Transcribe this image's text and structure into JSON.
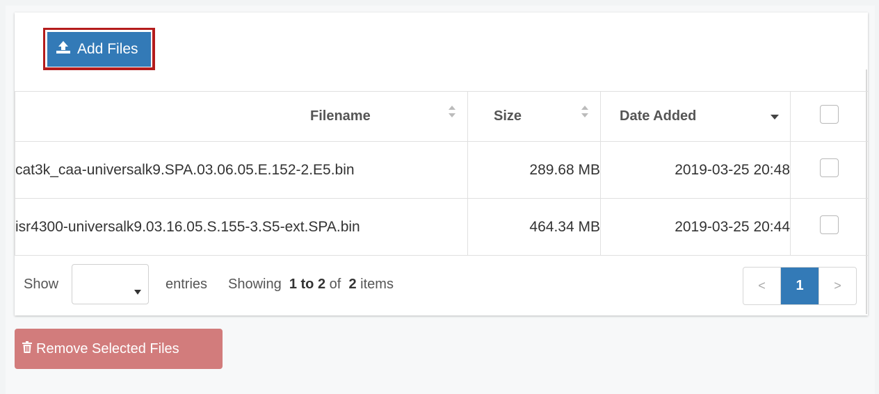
{
  "toolbar": {
    "add_files_label": "Add Files"
  },
  "table": {
    "columns": [
      "Filename",
      "Size",
      "Date Added"
    ],
    "rows": [
      {
        "filename": "cat3k_caa-universalk9.SPA.03.06.05.E.152-2.E5.bin",
        "size": "289.68 MB",
        "date_added": "2019-03-25 20:48"
      },
      {
        "filename": "isr4300-universalk9.03.16.05.S.155-3.S5-ext.SPA.bin",
        "size": "464.34 MB",
        "date_added": "2019-03-25 20:44"
      }
    ]
  },
  "footer": {
    "show_label": "Show",
    "entries_select_value": "",
    "entries_label": "entries",
    "showing_prefix": "Showing",
    "range": "1 to 2",
    "of_label": "of",
    "total": "2",
    "items_label": "items"
  },
  "pagination": {
    "prev": "<",
    "current": "1",
    "next": ">"
  },
  "actions": {
    "remove_label": "Remove Selected Files"
  },
  "colors": {
    "primary": "#337ab7",
    "danger_disabled": "#d27c7c",
    "highlight_border": "#b41c1c"
  },
  "icons": {
    "add": "upload-icon",
    "remove": "trash-icon",
    "sort": "sort-icon",
    "sort_desc": "sort-desc-icon"
  }
}
